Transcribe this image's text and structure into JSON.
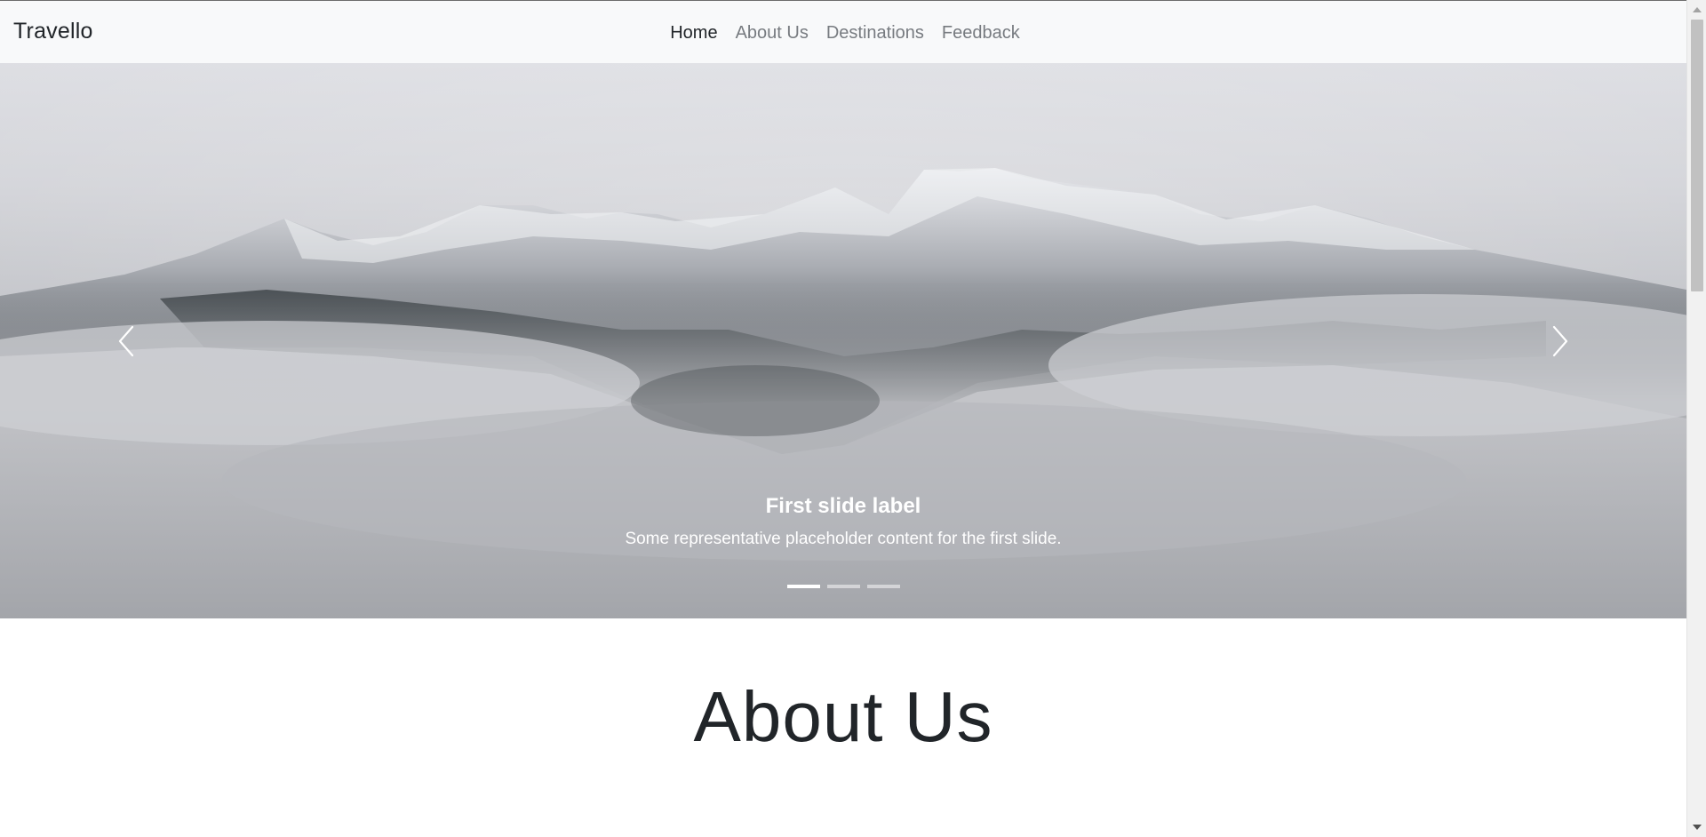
{
  "navbar": {
    "brand": "Travello",
    "links": [
      {
        "label": "Home",
        "active": true
      },
      {
        "label": "About Us",
        "active": false
      },
      {
        "label": "Destinations",
        "active": false
      },
      {
        "label": "Feedback",
        "active": false
      }
    ]
  },
  "carousel": {
    "caption_title": "First slide label",
    "caption_text": "Some representative placeholder content for the first slide.",
    "prev_icon": "chevron-left-icon",
    "next_icon": "chevron-right-icon",
    "slide_count": 3,
    "active_slide": 1
  },
  "about": {
    "title": "About Us"
  },
  "colors": {
    "navbar_bg": "#f8f9fa",
    "link_active": "#212529",
    "link_muted": "#777b80",
    "caption": "#ffffff"
  }
}
